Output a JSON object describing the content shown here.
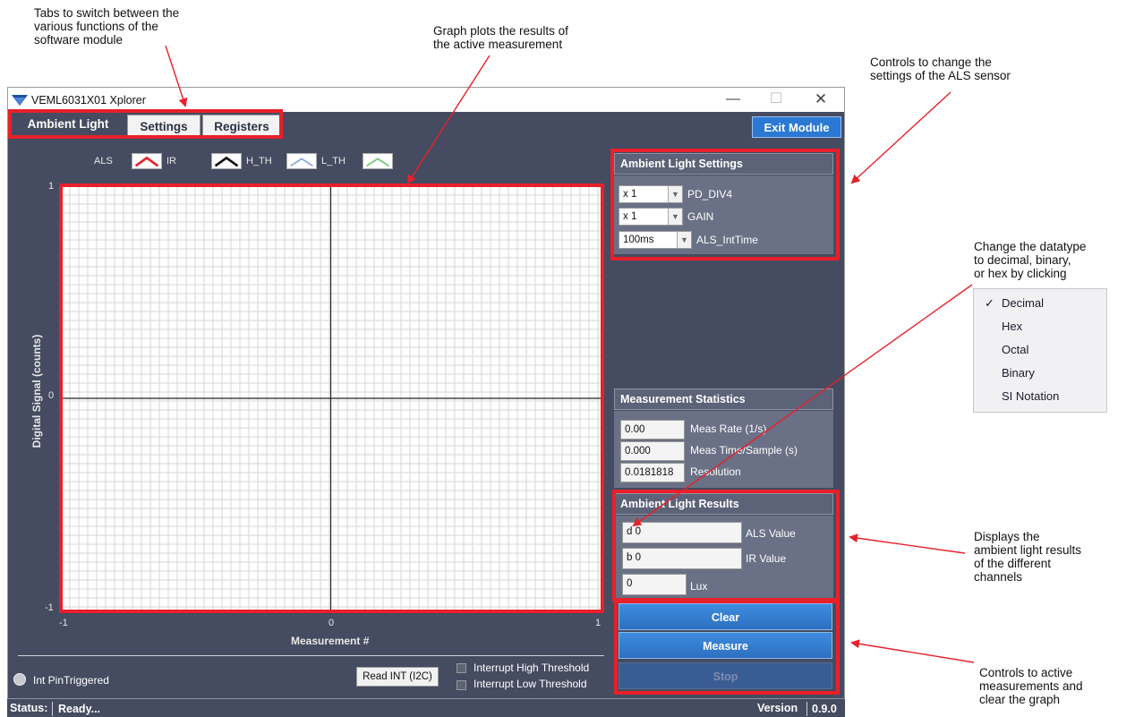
{
  "annotations": {
    "tabs_note": [
      "Tabs to switch between the",
      "various functions of the",
      "software module"
    ],
    "graph_note": [
      "Graph plots the results of",
      "the active measurement"
    ],
    "controls_note": [
      "Controls to change the",
      "settings of the ALS sensor"
    ],
    "datatype_note": [
      "Change the datatype",
      "to decimal, binary,",
      "or hex by clicking"
    ],
    "results_note": [
      "Displays the",
      "ambient light results",
      "of the different",
      "channels"
    ],
    "measure_note": [
      "Controls to active",
      "measurements and",
      "clear the graph"
    ]
  },
  "window": {
    "title": "VEML6031X01 Xplorer",
    "minimize": "—",
    "maximize": "☐",
    "close": "✕"
  },
  "tabs": [
    {
      "label": "Ambient Light",
      "active": true
    },
    {
      "label": "Settings",
      "active": false
    },
    {
      "label": "Registers",
      "active": false
    }
  ],
  "exit_button": "Exit Module",
  "legend": [
    {
      "label": "ALS"
    },
    {
      "label": "IR",
      "color": "#e8202a"
    },
    {
      "label": "H_TH",
      "color": "#111111"
    },
    {
      "label": "L_TH",
      "color": "#8fa8e0"
    },
    {
      "color": "#79c77a"
    }
  ],
  "chart_data": {
    "type": "line",
    "series": [],
    "xlabel": "Measurement #",
    "ylabel": "Digital Signal  (counts)",
    "xlim": [
      -1,
      1
    ],
    "ylim": [
      -1,
      1
    ],
    "x_ticks": [
      "-1",
      "0",
      "1"
    ],
    "y_ticks": [
      "1",
      "0",
      "-1"
    ],
    "grid": true
  },
  "ambient_light_settings": {
    "title": "Ambient Light Settings",
    "rows": [
      {
        "value": "x 1",
        "label": "PD_DIV4"
      },
      {
        "value": "x 1",
        "label": "GAIN"
      },
      {
        "value": "100ms",
        "label": "ALS_IntTime"
      }
    ]
  },
  "measurement_statistics": {
    "title": "Measurement Statistics",
    "rows": [
      {
        "value": "0.00",
        "label": "Meas Rate (1/s)"
      },
      {
        "value": "0.000",
        "label": "Meas Time/Sample (s)"
      },
      {
        "value": "0.0181818",
        "label": "Resolution"
      }
    ]
  },
  "ambient_light_results": {
    "title": "Ambient Light Results",
    "rows": [
      {
        "value": "d 0",
        "label": "ALS Value"
      },
      {
        "value": "b 0",
        "label": "IR Value"
      },
      {
        "value": "0",
        "label": "Lux"
      }
    ]
  },
  "buttons": {
    "clear": "Clear",
    "measure": "Measure",
    "stop": "Stop",
    "read_int": "Read INT (I2C)"
  },
  "interrupts": {
    "pin_triggered": "Int PinTriggered",
    "high": "Interrupt High Threshold",
    "low": "Interrupt Low Threshold"
  },
  "status": {
    "label": "Status:",
    "value": "Ready...",
    "version_label": "Version",
    "version_value": "0.9.0"
  },
  "datatype_menu": {
    "items": [
      {
        "label": "Decimal",
        "checked": true
      },
      {
        "label": "Hex"
      },
      {
        "label": "Octal"
      },
      {
        "label": "Binary"
      },
      {
        "label": "SI Notation"
      }
    ],
    "check_mark": "✓"
  },
  "colors": {
    "highlight": "#e8202a",
    "window_bg": "#454b60",
    "accent_button": "#2b79d4"
  }
}
